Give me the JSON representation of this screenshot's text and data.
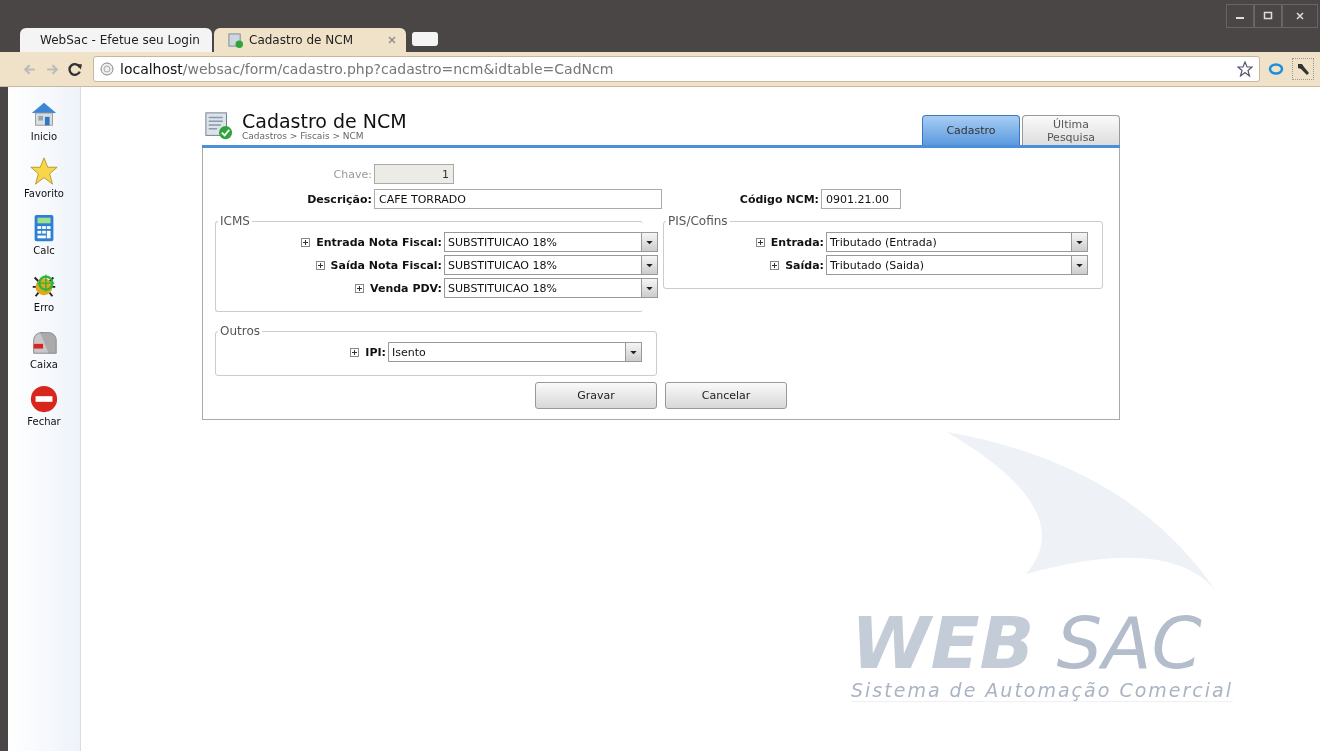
{
  "browser": {
    "tabs": [
      {
        "title": "WebSac - Efetue seu Login",
        "selected": false
      },
      {
        "title": "Cadastro de NCM",
        "selected": true
      }
    ],
    "address": {
      "host": "localhost",
      "path": "/websac/form/cadastro.php?cadastro=ncm&idtable=CadNcm"
    }
  },
  "sidebar": {
    "items": [
      {
        "label": "Inicio",
        "kind": "home"
      },
      {
        "label": "Favorito",
        "kind": "favorite"
      },
      {
        "label": "Calc",
        "kind": "calc"
      },
      {
        "label": "Erro",
        "kind": "error"
      },
      {
        "label": "Caixa",
        "kind": "mailbox"
      },
      {
        "label": "Fechar",
        "kind": "close"
      }
    ]
  },
  "page": {
    "title": "Cadastro de NCM",
    "breadcrumb": "Cadastros > Fiscais > NCM",
    "tabs": [
      {
        "label": "Cadastro",
        "selected": true
      },
      {
        "label": "Última Pesquisa",
        "selected": false
      }
    ]
  },
  "form": {
    "chave": {
      "label": "Chave:",
      "value": "1",
      "disabled": true
    },
    "descricao": {
      "label": "Descrição:",
      "value": "CAFE TORRADO"
    },
    "codigo_ncm": {
      "label": "Código NCM:",
      "value": "0901.21.00"
    },
    "groups": [
      {
        "title": "ICMS",
        "fields": [
          {
            "label": "Entrada Nota Fiscal:",
            "value": "SUBSTITUICAO 18%"
          },
          {
            "label": "Saída Nota Fiscal:",
            "value": "SUBSTITUICAO 18%"
          },
          {
            "label": "Venda PDV:",
            "value": "SUBSTITUICAO 18%"
          }
        ]
      },
      {
        "title": "PIS/Cofins",
        "fields": [
          {
            "label": "Entrada:",
            "value": "Tributado (Entrada)"
          },
          {
            "label": "Saída:",
            "value": "Tributado (Saida)"
          }
        ]
      },
      {
        "title": "Outros",
        "fields": [
          {
            "label": "IPI:",
            "value": "Isento"
          }
        ]
      }
    ],
    "buttons": [
      "Gravar",
      "Cancelar"
    ]
  },
  "background_logo": {
    "brand_bold": "WEB",
    "brand_light": "SAC",
    "tagline": "Sistema de Automação Comercial"
  }
}
